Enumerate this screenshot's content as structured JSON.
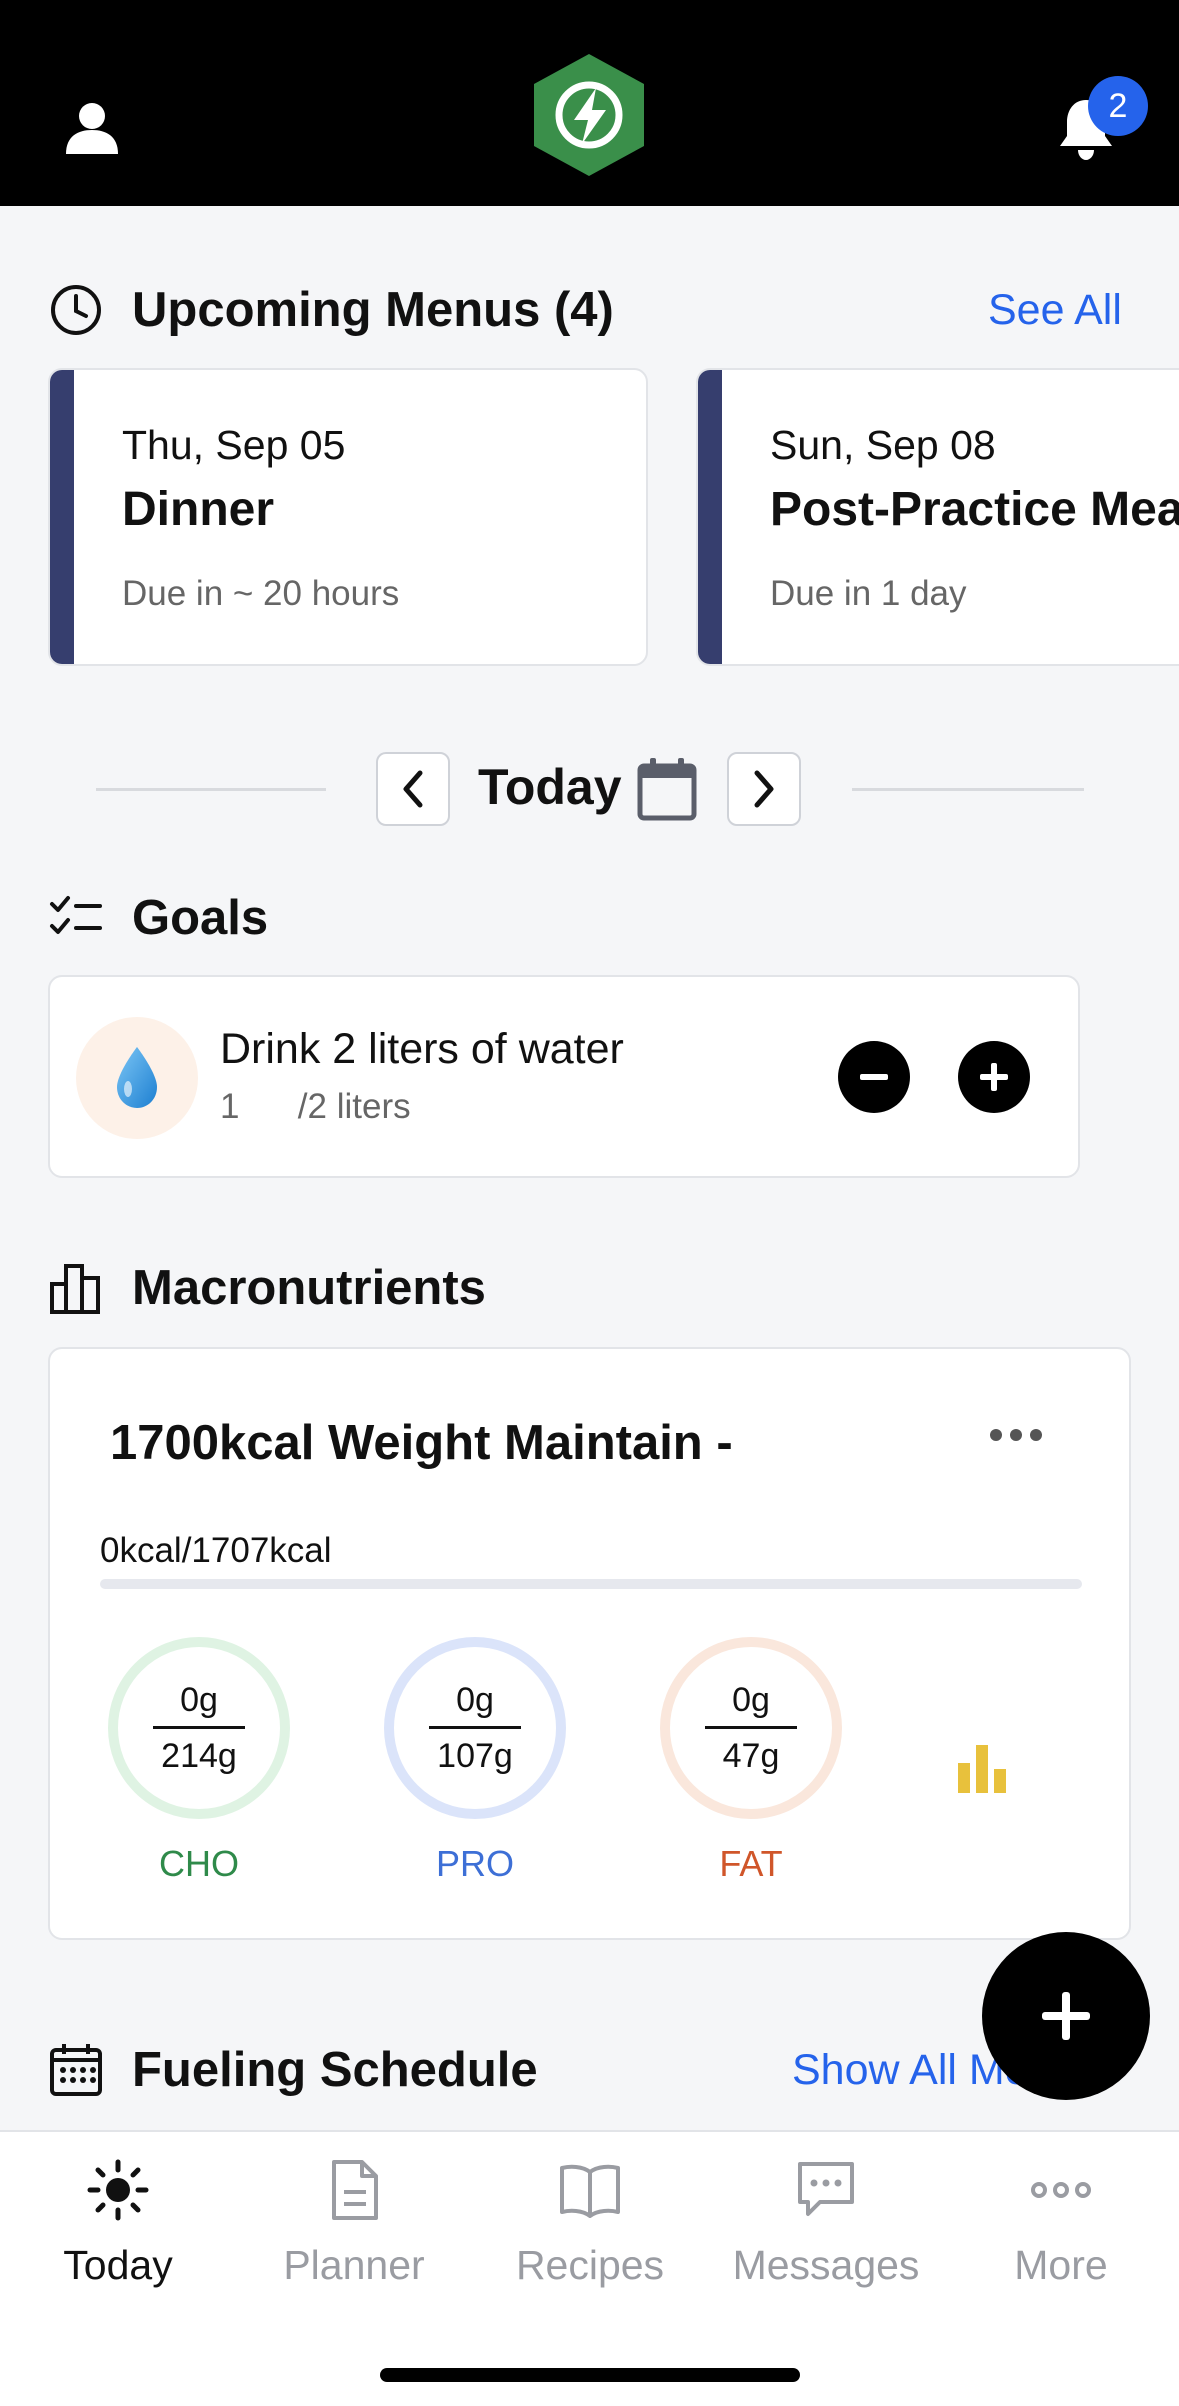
{
  "header": {
    "notification_count": "2",
    "brand_color": "#3a8f4a"
  },
  "upcoming": {
    "title": "Upcoming Menus (4)",
    "see_all": "See All",
    "accent_color": "#363e6e",
    "cards": [
      {
        "date": "Thu, Sep 05",
        "meal": "Dinner",
        "due": "Due in ~ 20 hours"
      },
      {
        "date": "Sun, Sep 08",
        "meal": "Post-Practice Meal",
        "due": "Due in 1 day"
      }
    ]
  },
  "date_nav": {
    "label": "Today"
  },
  "goals": {
    "title": "Goals",
    "items": [
      {
        "title": "Drink 2 liters of water",
        "progress": "1      /2 liters"
      }
    ]
  },
  "macros": {
    "title": "Macronutrients",
    "plan_name": "1700kcal Weight Maintain -",
    "kcal_text": "0kcal/1707kcal",
    "kcal_progress": 0,
    "rings": [
      {
        "current": "0g",
        "total": "214g",
        "label": "CHO",
        "color": "#2f8a4a",
        "ring_color": "#dff3e3"
      },
      {
        "current": "0g",
        "total": "107g",
        "label": "PRO",
        "color": "#3d6fd6",
        "ring_color": "#dbe4fa"
      },
      {
        "current": "0g",
        "total": "47g",
        "label": "FAT",
        "color": "#d0562a",
        "ring_color": "#fae7dc"
      }
    ]
  },
  "fueling": {
    "title": "Fueling Schedule",
    "show_all": "Show All Meals"
  },
  "tabs": [
    {
      "label": "Today",
      "icon": "sun-icon",
      "active": true
    },
    {
      "label": "Planner",
      "icon": "document-icon",
      "active": false
    },
    {
      "label": "Recipes",
      "icon": "book-icon",
      "active": false
    },
    {
      "label": "Messages",
      "icon": "chat-icon",
      "active": false
    },
    {
      "label": "More",
      "icon": "more-icon",
      "active": false
    }
  ]
}
